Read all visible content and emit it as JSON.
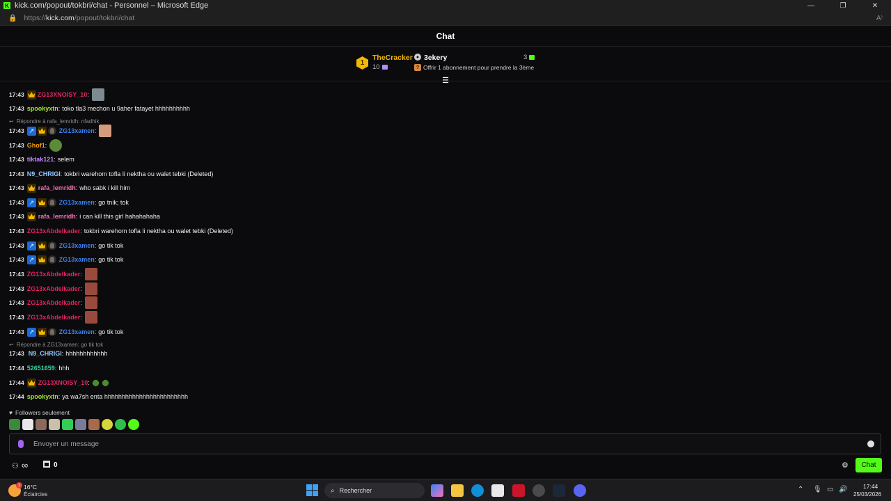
{
  "window": {
    "title": "kick.com/popout/tokbri/chat - Personnel – Microsoft Edge"
  },
  "address": {
    "scheme": "https://",
    "host": "kick.com",
    "path": "/popout/tokbri/chat"
  },
  "chat": {
    "title": "Chat",
    "mode_label": "Followers seulement",
    "input_placeholder": "Envoyer un message"
  },
  "leaderboard": {
    "rank": "1",
    "first": {
      "name": "TheCracker",
      "count": "10"
    },
    "second": {
      "name": "3ekery",
      "count": "3"
    },
    "offer": "Offrir 1 abonnement pour prendre la 3ème"
  },
  "replies": [
    "Répondre à rafa_lemridh: nfadhik",
    "Répondre à ZG13xamen: go tik tok"
  ],
  "messages": [
    {
      "time": "17:43",
      "user": "ZG13XNOISY_10",
      "sep": ":"
    },
    {
      "time": "17:43",
      "user": "spookyxtn",
      "sep": ":",
      "text": "toko tla3 mechon u 9aher fatayet hhhhhhhhhh"
    },
    {
      "time": "17:43",
      "user": "ZG13xamen",
      "sep": ":"
    },
    {
      "time": "17:43",
      "user": "Ghof1",
      "sep": ":"
    },
    {
      "time": "17:43",
      "user": "tiktak121",
      "sep": ":",
      "text": "selem"
    },
    {
      "time": "17:43",
      "user": "N9_CHRIGI",
      "sep": ":",
      "text": "tokbri warehom tofla li nektha ou walet tebki (Deleted)"
    },
    {
      "time": "17:43",
      "user": "rafa_lemridh",
      "sep": ":",
      "text": "who sabk i kill him"
    },
    {
      "time": "17:43",
      "user": "ZG13xamen",
      "sep": ":",
      "text": "go tnik; tok"
    },
    {
      "time": "17:43",
      "user": "rafa_lemridh",
      "sep": ":",
      "text": "i can kill this girl hahahahaha"
    },
    {
      "time": "17:43",
      "user": "ZG13xAbdelkader",
      "sep": ":",
      "text": "tokbri warehom tofla li nektha ou walet tebki (Deleted)"
    },
    {
      "time": "17:43",
      "user": "ZG13xamen",
      "sep": ":",
      "text": "go tik tok"
    },
    {
      "time": "17:43",
      "user": "ZG13xamen",
      "sep": ":",
      "text": "go tik tok"
    },
    {
      "time": "17:43",
      "user": "ZG13xAbdelkader",
      "sep": ":"
    },
    {
      "time": "17:43",
      "user": "ZG13xAbdelkader",
      "sep": ":"
    },
    {
      "time": "17:43",
      "user": "ZG13xAbdelkader",
      "sep": ":"
    },
    {
      "time": "17:43",
      "user": "ZG13xAbdelkader",
      "sep": ":"
    },
    {
      "time": "17:43",
      "user": "ZG13xamen",
      "sep": ":",
      "text": "go tik tok"
    },
    {
      "time": "17:43",
      "user": "N9_CHRIGI",
      "sep": ":",
      "text": "hhhhhhhhhhhh"
    },
    {
      "time": "17:44",
      "user": "52651659",
      "sep": ":",
      "text": "hhh"
    },
    {
      "time": "17:44",
      "user": "ZG13XNOISY_10",
      "sep": ":"
    },
    {
      "time": "17:44",
      "user": "spookyxtn",
      "sep": ":",
      "text": "ya wa7sh enta hhhhhhhhhhhhhhhhhhhhhhhh"
    }
  ],
  "footer": {
    "points": "0",
    "chat_button": "Chat"
  },
  "taskbar": {
    "weather_badge": "1",
    "temperature": "16°C",
    "weather": "Éclaircies",
    "search_label": "Rechercher",
    "time": "17:44",
    "date": "25/03/2026"
  },
  "colors": {
    "accent": "#53fc18",
    "background": "#0b0b0d",
    "gold": "#f5b800",
    "username_red": "#e0245e",
    "username_blue": "#3b82f6"
  }
}
